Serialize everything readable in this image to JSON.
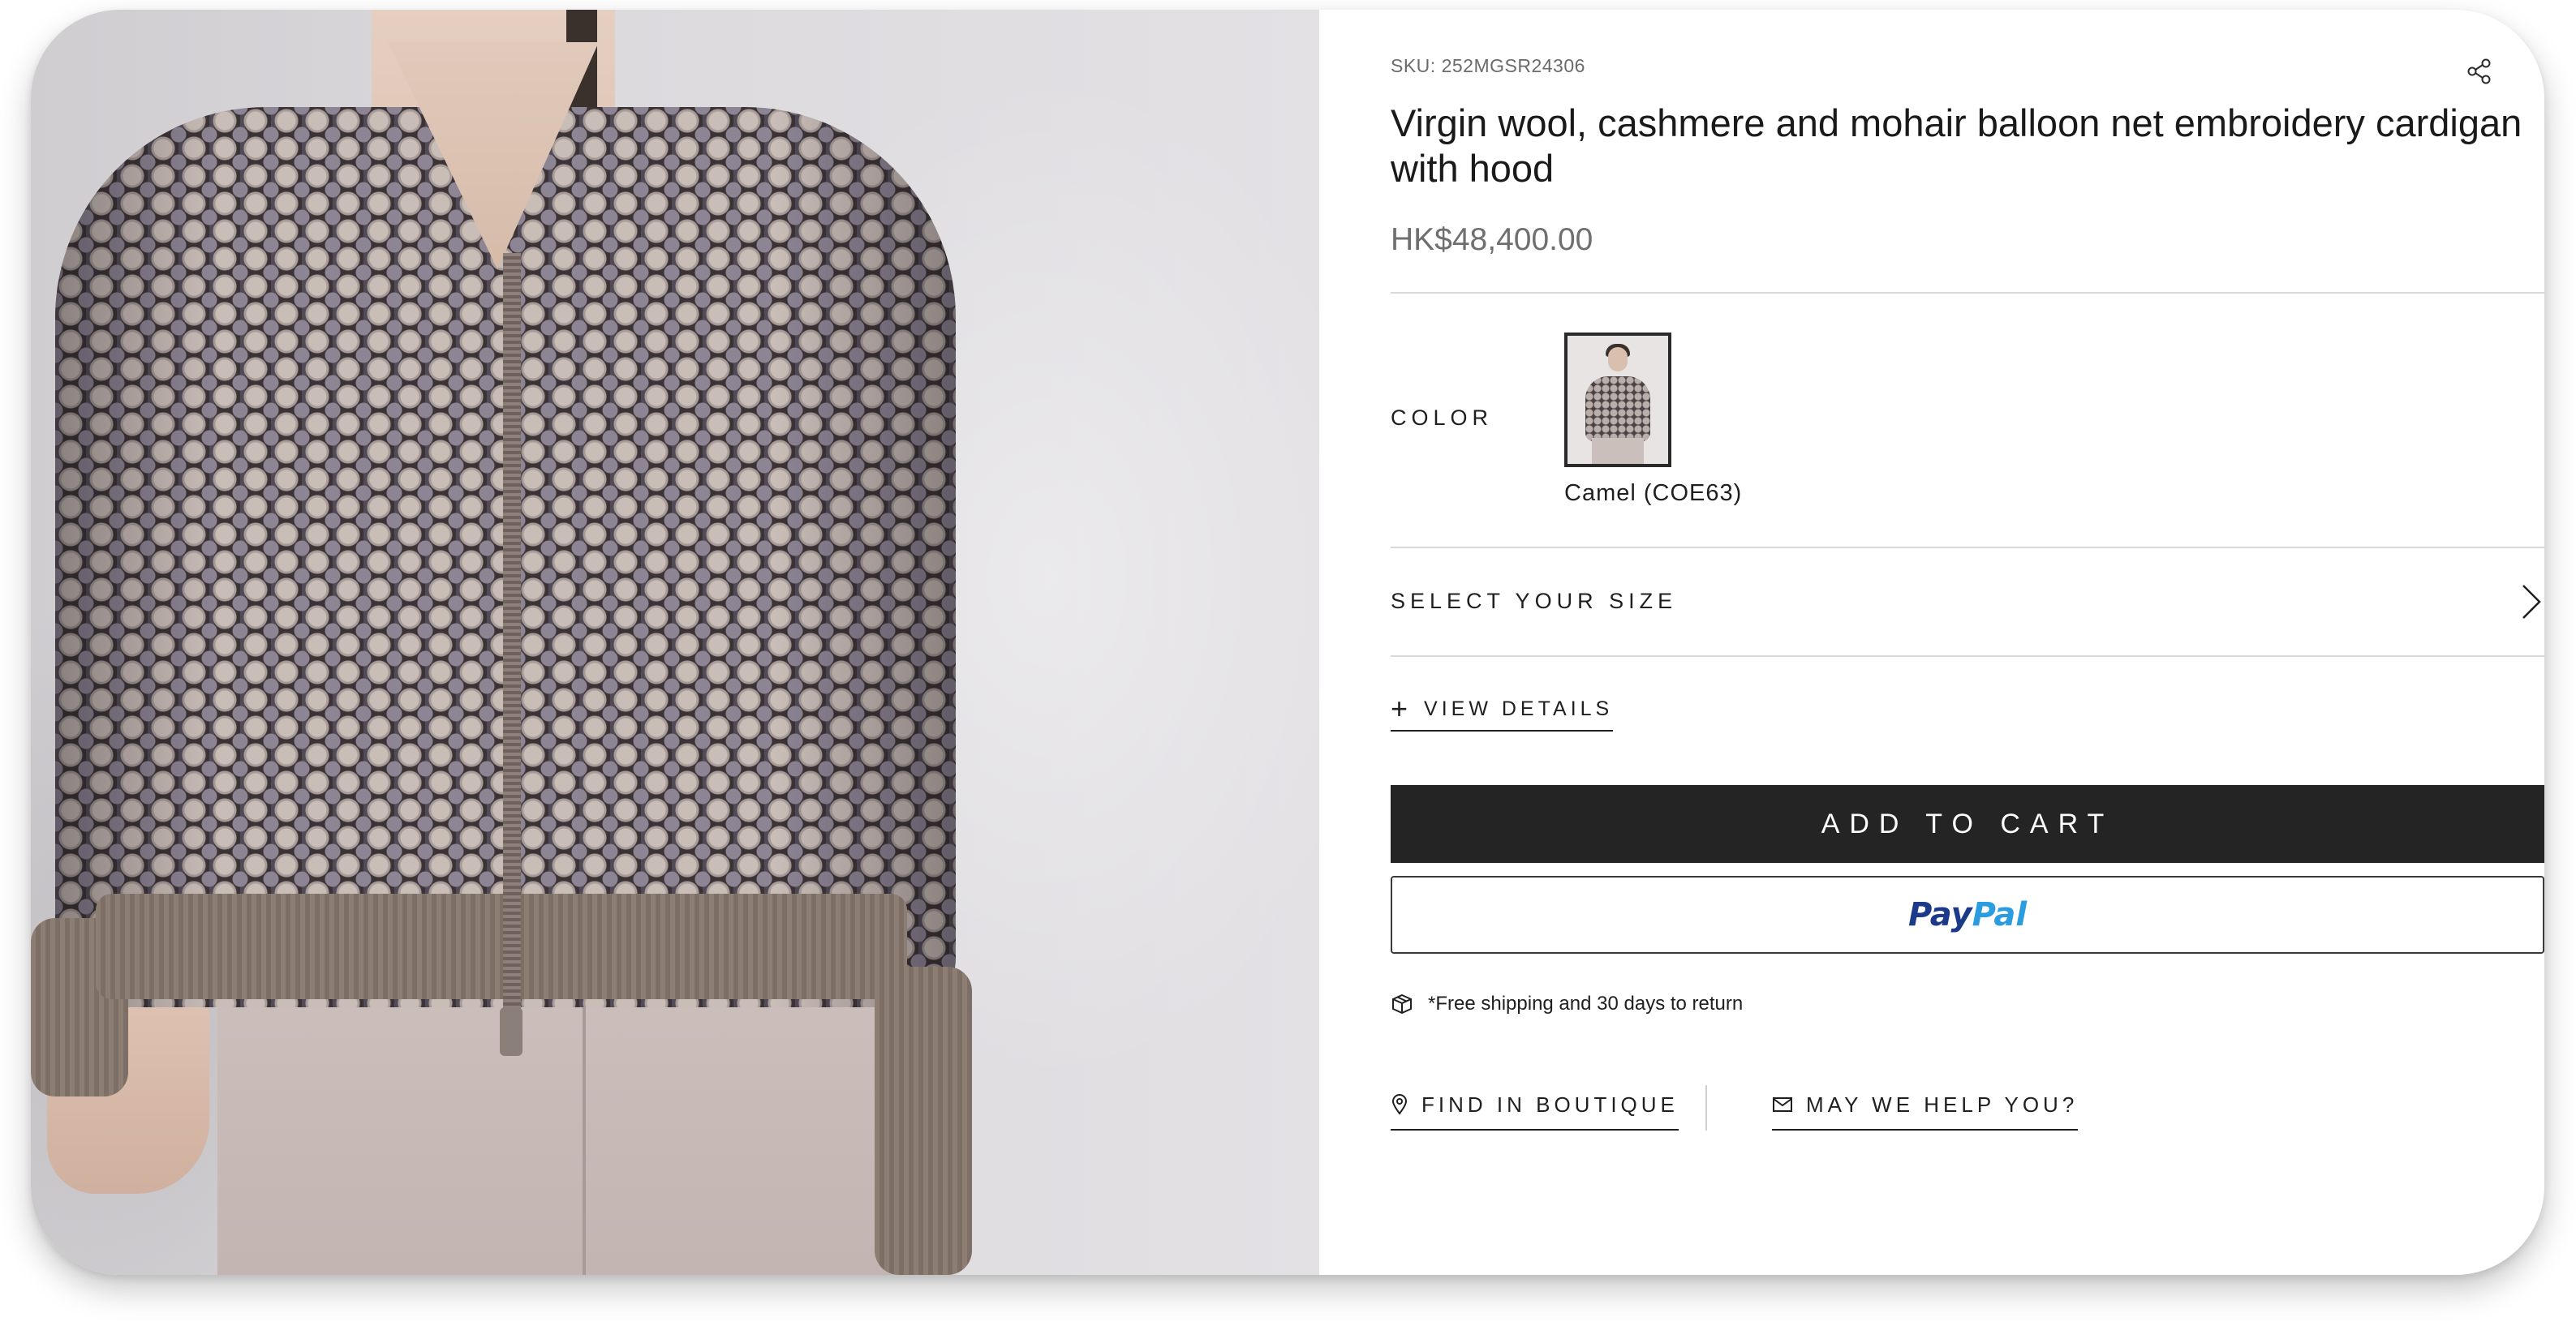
{
  "product": {
    "sku": "SKU: 252MGSR24306",
    "title": "Virgin wool, cashmere and mohair balloon net embroidery cardigan with hood",
    "price": "HK$48,400.00",
    "image_alt": "Model wearing cardigan",
    "share_icon": "share-icon"
  },
  "color": {
    "label": "COLOR",
    "selected": "Camel (COE63)"
  },
  "size": {
    "label": "SELECT YOUR SIZE",
    "icon": "chevron-right-icon"
  },
  "details": {
    "plus": "+",
    "label": "VIEW DETAILS"
  },
  "actions": {
    "add_to_cart": "ADD TO CART",
    "paypal_part1": "Pay",
    "paypal_part2": "Pal"
  },
  "shipping": {
    "icon": "package-icon",
    "text": "*Free shipping and 30 days to return"
  },
  "links": {
    "boutique": "FIND IN BOUTIQUE",
    "boutique_icon": "map-pin-icon",
    "help": "MAY WE HELP YOU?",
    "help_icon": "mail-icon"
  },
  "colors": {
    "button_dark": "#242424",
    "paypal_blue": "#1b3a8a",
    "paypal_light": "#2a9ce0",
    "price_gray": "#6f6f6f"
  }
}
